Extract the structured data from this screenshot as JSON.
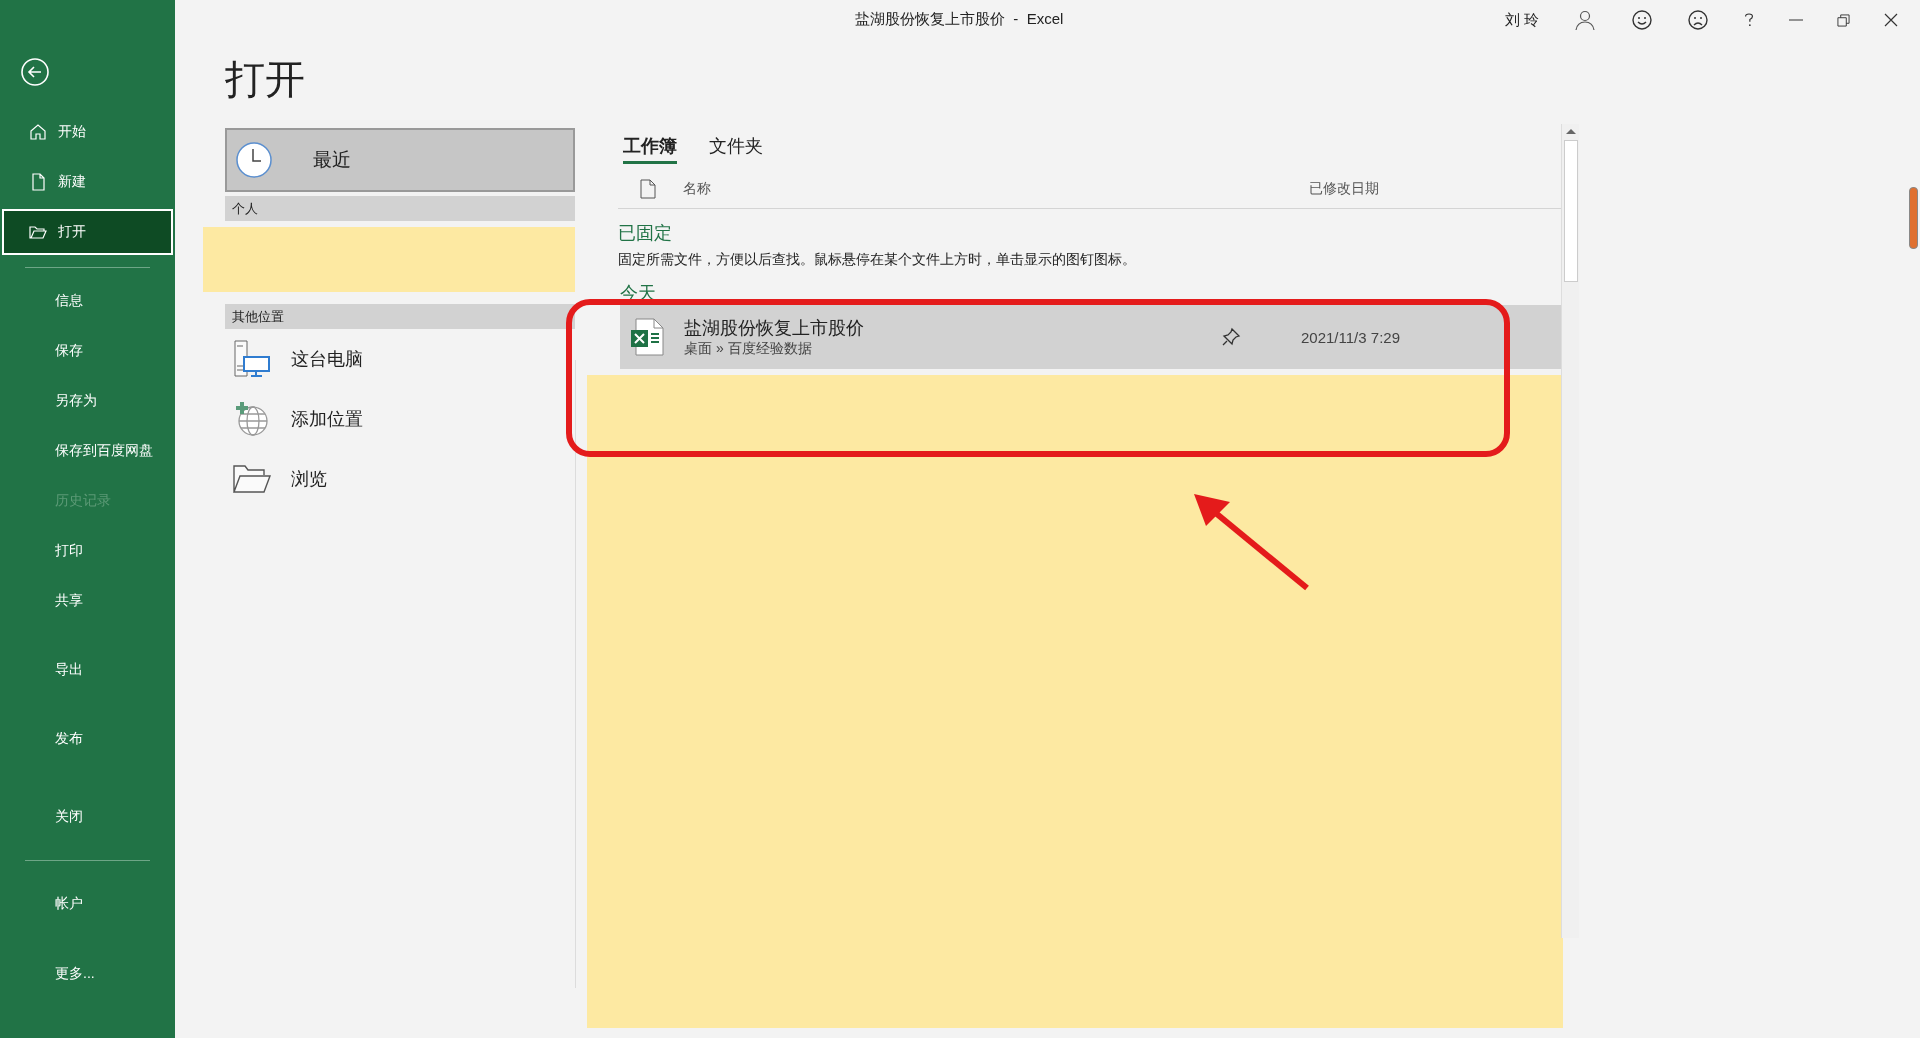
{
  "window": {
    "title": "盐湖股份恢复上市股价  -  Excel",
    "user": "刘 玲"
  },
  "sidebar": {
    "nav": [
      {
        "label": "开始",
        "selected": false
      },
      {
        "label": "新建",
        "selected": false
      },
      {
        "label": "打开",
        "selected": true
      }
    ],
    "menu": [
      {
        "label": "信息",
        "disabled": false
      },
      {
        "label": "保存",
        "disabled": false
      },
      {
        "label": "另存为",
        "disabled": false
      },
      {
        "label": "保存到百度网盘",
        "disabled": false
      },
      {
        "label": "历史记录",
        "disabled": true
      },
      {
        "label": "打印",
        "disabled": false
      },
      {
        "label": "共享",
        "disabled": false
      },
      {
        "label": "导出",
        "disabled": false
      },
      {
        "label": "发布",
        "disabled": false
      },
      {
        "label": "关闭",
        "disabled": false
      }
    ],
    "footer": [
      {
        "label": "帐户"
      },
      {
        "label": "更多..."
      }
    ]
  },
  "open_panel": {
    "title": "打开",
    "recent": {
      "label": "最近",
      "selected": true
    },
    "personal_header": "个人",
    "other_header": "其他位置",
    "other_locations": [
      {
        "label": "这台电脑"
      },
      {
        "label": "添加位置"
      },
      {
        "label": "浏览"
      }
    ]
  },
  "files": {
    "tabs": [
      {
        "label": "工作簿",
        "selected": true
      },
      {
        "label": "文件夹",
        "selected": false
      }
    ],
    "columns": [
      "名称",
      "已修改日期"
    ],
    "pinned": {
      "heading": "已固定",
      "hint": "固定所需文件，方便以后查找。鼠标悬停在某个文件上方时，单击显示的图钉图标。"
    },
    "groups": [
      {
        "heading": "今天",
        "files": [
          {
            "name": "盐湖股份恢复上市股价",
            "path": "桌面 » 百度经验数据",
            "modified": "2021/11/3 7:29"
          }
        ]
      }
    ]
  }
}
